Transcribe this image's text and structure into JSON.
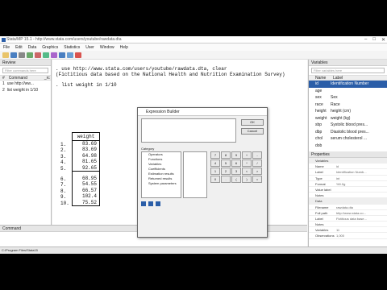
{
  "titlebar": {
    "title": "Stata/MP 15.1 - http://www.stata.com/users/youtube/rawdata.dta"
  },
  "menu": [
    "File",
    "Edit",
    "Data",
    "Graphics",
    "Statistics",
    "User",
    "Window",
    "Help"
  ],
  "review": {
    "title": "Review",
    "search_placeholder": "Filter commands here",
    "columns": [
      "#",
      "Command",
      "_rc"
    ],
    "rows": [
      {
        "n": "1",
        "cmd": "use http://ww..."
      },
      {
        "n": "2",
        "cmd": "list weight in 1/10"
      }
    ]
  },
  "results": {
    "line1": ". use http://www.stata.com/users/youtube/rawdata.dta, clear",
    "line2": "(Fictitious data based on the National Health and Nutrition Examination Survey)",
    "line3": ". list weight in 1/10",
    "table_header": "weight",
    "rows": [
      {
        "n": "1.",
        "v": "83.69"
      },
      {
        "n": "2.",
        "v": "83.69"
      },
      {
        "n": "3.",
        "v": "64.98"
      },
      {
        "n": "4.",
        "v": "81.65"
      },
      {
        "n": "5.",
        "v": "92.65"
      },
      {
        "n": "6.",
        "v": "68.95"
      },
      {
        "n": "7.",
        "v": "54.55"
      },
      {
        "n": "8.",
        "v": "66.57"
      },
      {
        "n": "9.",
        "v": "102.4"
      },
      {
        "n": "10.",
        "v": "75.52"
      }
    ]
  },
  "variables": {
    "title": "Variables",
    "search_placeholder": "Filter variables here",
    "columns": [
      "Name",
      "Label"
    ],
    "items": [
      {
        "name": "id",
        "label": "Identification Number"
      },
      {
        "name": "age",
        "label": ""
      },
      {
        "name": "sex",
        "label": "Sex"
      },
      {
        "name": "race",
        "label": "Race"
      },
      {
        "name": "height",
        "label": "height (cm)"
      },
      {
        "name": "weight",
        "label": "weight (kg)"
      },
      {
        "name": "sbp",
        "label": "Systolic blood pres..."
      },
      {
        "name": "dbp",
        "label": "Diastolic blood pres..."
      },
      {
        "name": "chol",
        "label": "serum cholesterol ..."
      },
      {
        "name": "dob",
        "label": ""
      }
    ]
  },
  "properties": {
    "title": "Properties",
    "rows": [
      {
        "k": "Variables",
        "v": "",
        "sec": true
      },
      {
        "k": "Name",
        "v": "id"
      },
      {
        "k": "Label",
        "v": "Identification Numb..."
      },
      {
        "k": "Type",
        "v": "int"
      },
      {
        "k": "Format",
        "v": "%9.0g"
      },
      {
        "k": "Value label",
        "v": ""
      },
      {
        "k": "Notes",
        "v": ""
      },
      {
        "k": "Data",
        "v": "",
        "sec": true
      },
      {
        "k": "Filename",
        "v": "rawdata.dta"
      },
      {
        "k": "Full path",
        "v": "http://www.stata.co..."
      },
      {
        "k": "Label",
        "v": "Fictitious data base..."
      },
      {
        "k": "Notes",
        "v": ""
      },
      {
        "k": "Variables",
        "v": "11"
      },
      {
        "k": "Observations",
        "v": "1,000"
      }
    ]
  },
  "command": {
    "title": "Command"
  },
  "status": {
    "path": "C:\\Program Files\\Stata15"
  },
  "dialog": {
    "title": "Expression Builder",
    "ok": "OK",
    "cancel": "Cancel",
    "category_label": "Category",
    "categories": [
      "Operators",
      "Functions",
      "Variables",
      "Coefficients",
      "Estimation results",
      "Returned results",
      "System parameters"
    ],
    "keys": [
      "7",
      "8",
      "9",
      "+",
      "-",
      "4",
      "5",
      "6",
      "*",
      "/",
      "1",
      "2",
      "3",
      "<",
      ">",
      "0",
      ".",
      "(",
      ")",
      "="
    ]
  }
}
